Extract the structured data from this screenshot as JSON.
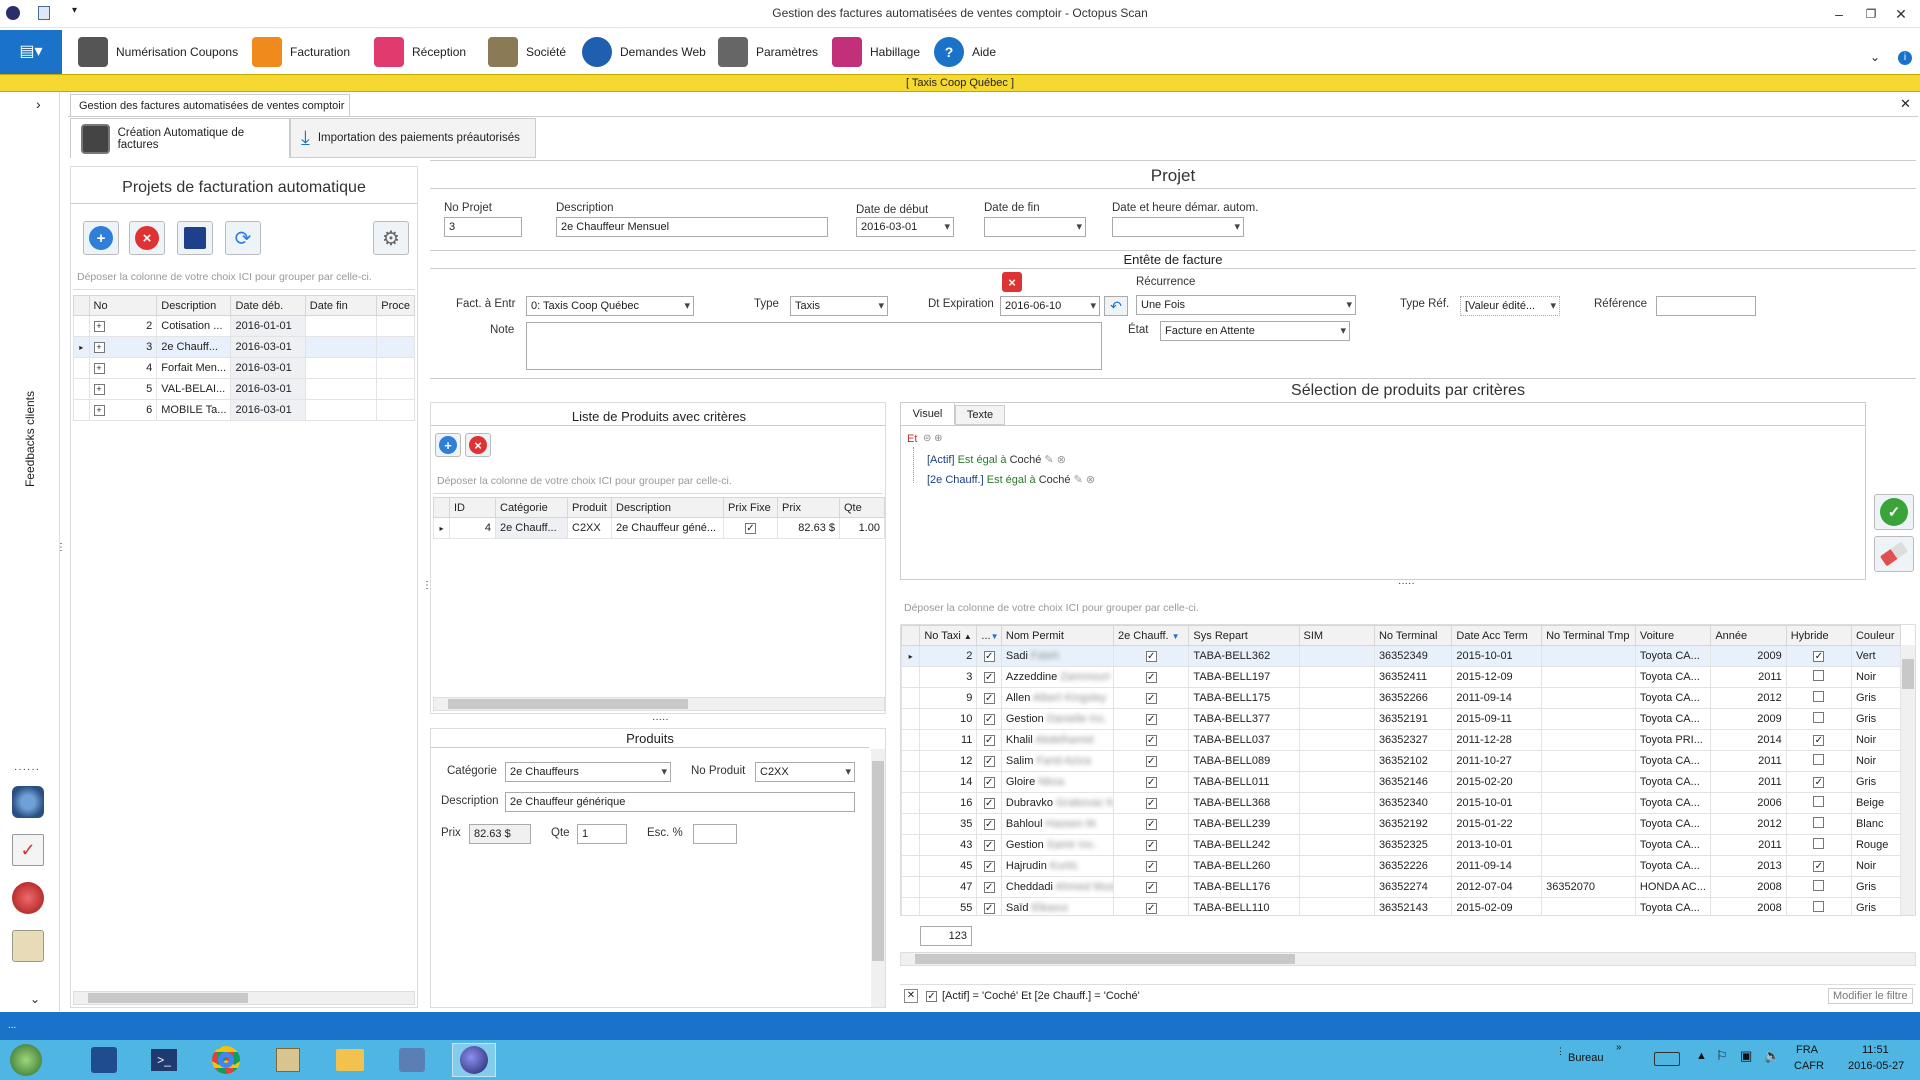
{
  "window": {
    "title": "Gestion des factures automatisées de ventes comptoir - Octopus Scan"
  },
  "ribbon": {
    "items": [
      {
        "label": "Numérisation Coupons",
        "icon": "scanner-icon",
        "color": "#555555"
      },
      {
        "label": "Facturation",
        "icon": "invoice-icon",
        "color": "#f08a1c"
      },
      {
        "label": "Réception",
        "icon": "house-icon",
        "color": "#e03a6e"
      },
      {
        "label": "Société",
        "icon": "building-icon",
        "color": "#8a7a55"
      },
      {
        "label": "Demandes Web",
        "icon": "globe-icon",
        "color": "#1f5fb0"
      },
      {
        "label": "Paramètres",
        "icon": "tools-icon",
        "color": "#666666"
      },
      {
        "label": "Habillage",
        "icon": "palette-icon",
        "color": "#c2307a"
      },
      {
        "label": "Aide",
        "icon": "help-icon",
        "color": "#1a73c8"
      }
    ]
  },
  "company_bar": "[   Taxis Coop Québec   ]",
  "rail": {
    "label": "Feedbacks clients"
  },
  "doc_tab": "Gestion des factures automatisées de ventes comptoir",
  "subtabs": [
    "Création Automatique de factures",
    "Importation des paiements préautorisés"
  ],
  "projects": {
    "title": "Projets de facturation automatique",
    "group_hint": "Déposer la colonne de votre choix ICI pour grouper par celle-ci.",
    "columns": [
      "No",
      "Description",
      "Date déb.",
      "Date fin",
      "Proce"
    ],
    "rows": [
      {
        "no": "2",
        "desc": "Cotisation ...",
        "start": "2016-01-01",
        "end": ""
      },
      {
        "no": "3",
        "desc": "2e Chauff...",
        "start": "2016-03-01",
        "end": ""
      },
      {
        "no": "4",
        "desc": "Forfait Men...",
        "start": "2016-03-01",
        "end": ""
      },
      {
        "no": "5",
        "desc": "VAL-BELAI...",
        "start": "2016-03-01",
        "end": ""
      },
      {
        "no": "6",
        "desc": "MOBILE Ta...",
        "start": "2016-03-01",
        "end": ""
      }
    ]
  },
  "projet": {
    "title": "Projet",
    "no_label": "No Projet",
    "no_value": "3",
    "desc_label": "Description",
    "desc_value": "2e Chauffeur Mensuel",
    "start_label": "Date de début",
    "start_value": "2016-03-01",
    "end_label": "Date de fin",
    "end_value": "",
    "auto_label": "Date et heure démar. autom.",
    "auto_value": ""
  },
  "entete": {
    "title": "Entête de facture",
    "fact_label": "Fact. à Entr",
    "fact_value": "0: Taxis Coop Québec",
    "type_label": "Type",
    "type_value": "Taxis",
    "exp_label": "Dt Expiration",
    "exp_value": "2016-06-10",
    "rec_label": "Récurrence",
    "rec_value": "Une Fois",
    "typeref_label": "Type Réf.",
    "typeref_value": "[Valeur édité...",
    "ref_label": "Référence",
    "ref_value": "",
    "note_label": "Note",
    "etat_label": "État",
    "etat_value": "Facture en Attente"
  },
  "products_list": {
    "title": "Liste de Produits avec critères",
    "group_hint": "Déposer la colonne de votre choix ICI pour grouper par celle-ci.",
    "columns": [
      "ID",
      "Catégorie",
      "Produit",
      "Description",
      "Prix Fixe",
      "Prix",
      "Qte"
    ],
    "rows": [
      {
        "id": "4",
        "cat": "2e Chauff...",
        "prod": "C2XX",
        "desc": "2e Chauffeur géné...",
        "fixed": true,
        "price": "82.63 $",
        "qty": "1.00"
      }
    ]
  },
  "produits": {
    "title": "Produits",
    "cat_label": "Catégorie",
    "cat_value": "2e Chauffeurs",
    "noprod_label": "No Produit",
    "noprod_value": "C2XX",
    "desc_label": "Description",
    "desc_value": "2e Chauffeur générique",
    "prix_label": "Prix",
    "prix_value": "82.63 $",
    "qte_label": "Qte",
    "qte_value": "1",
    "esc_label": "Esc. %",
    "esc_value": ""
  },
  "selection": {
    "title": "Sélection de produits par critères",
    "tabs": [
      "Visuel",
      "Texte"
    ],
    "root_op": "Et",
    "conditions": [
      {
        "field": "[Actif]",
        "op": "Est égal à",
        "value": "Coché"
      },
      {
        "field": "[2e Chauff.]",
        "op": "Est égal à",
        "value": "Coché"
      }
    ],
    "group_hint": "Déposer la colonne de votre choix ICI pour grouper par celle-ci.",
    "columns": [
      "No Taxi",
      "...",
      "Nom Permit",
      "2e Chauff.",
      "Sys Repart",
      "SIM",
      "No Terminal",
      "Date Acc Term",
      "No Terminal Tmp",
      "Voiture",
      "Année",
      "Hybride",
      "Couleur"
    ],
    "rows": [
      {
        "taxi": "2",
        "first": "Sadi",
        "last": "Fateh",
        "sys": "TABA-BELL362",
        "term": "36352349",
        "date": "2015-10-01",
        "tmp": "",
        "car": "Toyota CA...",
        "year": "2009",
        "hyb": true,
        "color": "Vert"
      },
      {
        "taxi": "3",
        "first": "Azzeddine",
        "last": "Zammouri",
        "sys": "TABA-BELL197",
        "term": "36352411",
        "date": "2015-12-09",
        "tmp": "",
        "car": "Toyota CA...",
        "year": "2011",
        "hyb": false,
        "color": "Noir"
      },
      {
        "taxi": "9",
        "first": "Allen",
        "last": "Albert Kingsley",
        "sys": "TABA-BELL175",
        "term": "36352266",
        "date": "2011-09-14",
        "tmp": "",
        "car": "Toyota CA...",
        "year": "2012",
        "hyb": false,
        "color": "Gris"
      },
      {
        "taxi": "10",
        "first": "Gestion",
        "last": "Danielle Inc.",
        "sys": "TABA-BELL377",
        "term": "36352191",
        "date": "2015-09-11",
        "tmp": "",
        "car": "Toyota CA...",
        "year": "2009",
        "hyb": false,
        "color": "Gris"
      },
      {
        "taxi": "11",
        "first": "Khalil",
        "last": "Abdelhamid",
        "sys": "TABA-BELL037",
        "term": "36352327",
        "date": "2011-12-28",
        "tmp": "",
        "car": "Toyota PRI...",
        "year": "2014",
        "hyb": true,
        "color": "Noir"
      },
      {
        "taxi": "12",
        "first": "Salim",
        "last": "Farid Aziza",
        "sys": "TABA-BELL089",
        "term": "36352102",
        "date": "2011-10-27",
        "tmp": "",
        "car": "Toyota CA...",
        "year": "2011",
        "hyb": false,
        "color": "Noir"
      },
      {
        "taxi": "14",
        "first": "Gloire",
        "last": "Nkoa",
        "sys": "TABA-BELL011",
        "term": "36352146",
        "date": "2015-02-20",
        "tmp": "",
        "car": "Toyota CA...",
        "year": "2011",
        "hyb": true,
        "color": "Gris"
      },
      {
        "taxi": "16",
        "first": "Dubravko",
        "last": "Grabovac K.",
        "sys": "TABA-BELL368",
        "term": "36352340",
        "date": "2015-10-01",
        "tmp": "",
        "car": "Toyota CA...",
        "year": "2006",
        "hyb": false,
        "color": "Beige"
      },
      {
        "taxi": "35",
        "first": "Bahloul",
        "last": "Hassen M.",
        "sys": "TABA-BELL239",
        "term": "36352192",
        "date": "2015-01-22",
        "tmp": "",
        "car": "Toyota CA...",
        "year": "2012",
        "hyb": false,
        "color": "Blanc"
      },
      {
        "taxi": "43",
        "first": "Gestion",
        "last": "Samir Inc.",
        "sys": "TABA-BELL242",
        "term": "36352325",
        "date": "2013-10-01",
        "tmp": "",
        "car": "Toyota CA...",
        "year": "2011",
        "hyb": false,
        "color": "Rouge"
      },
      {
        "taxi": "45",
        "first": "Hajrudin",
        "last": "Kurtic",
        "sys": "TABA-BELL260",
        "term": "36352226",
        "date": "2011-09-14",
        "tmp": "",
        "car": "Toyota CA...",
        "year": "2013",
        "hyb": true,
        "color": "Noir"
      },
      {
        "taxi": "47",
        "first": "Cheddadi",
        "last": "Ahmed Mustafa",
        "sys": "TABA-BELL176",
        "term": "36352274",
        "date": "2012-07-04",
        "tmp": "36352070",
        "car": "HONDA AC...",
        "year": "2008",
        "hyb": false,
        "color": "Gris"
      },
      {
        "taxi": "55",
        "first": "Saïd",
        "last": "Elkaoui",
        "sys": "TABA-BELL110",
        "term": "36352143",
        "date": "2015-02-09",
        "tmp": "",
        "car": "Toyota CA...",
        "year": "2008",
        "hyb": false,
        "color": "Gris"
      }
    ],
    "count": "123",
    "filter_text": "[Actif] = 'Coché' Et [2e Chauff.] = 'Coché'",
    "modify_filter": "Modifier le filtre"
  },
  "taskbar": {
    "lang": "FRA",
    "locale": "CAFR",
    "time": "11:51",
    "date": "2016-05-27",
    "desktop": "Bureau"
  },
  "colors": {
    "accent": "#1a73c8",
    "company_bar": "#f5d830",
    "taskbar": "#4fb6e3"
  }
}
